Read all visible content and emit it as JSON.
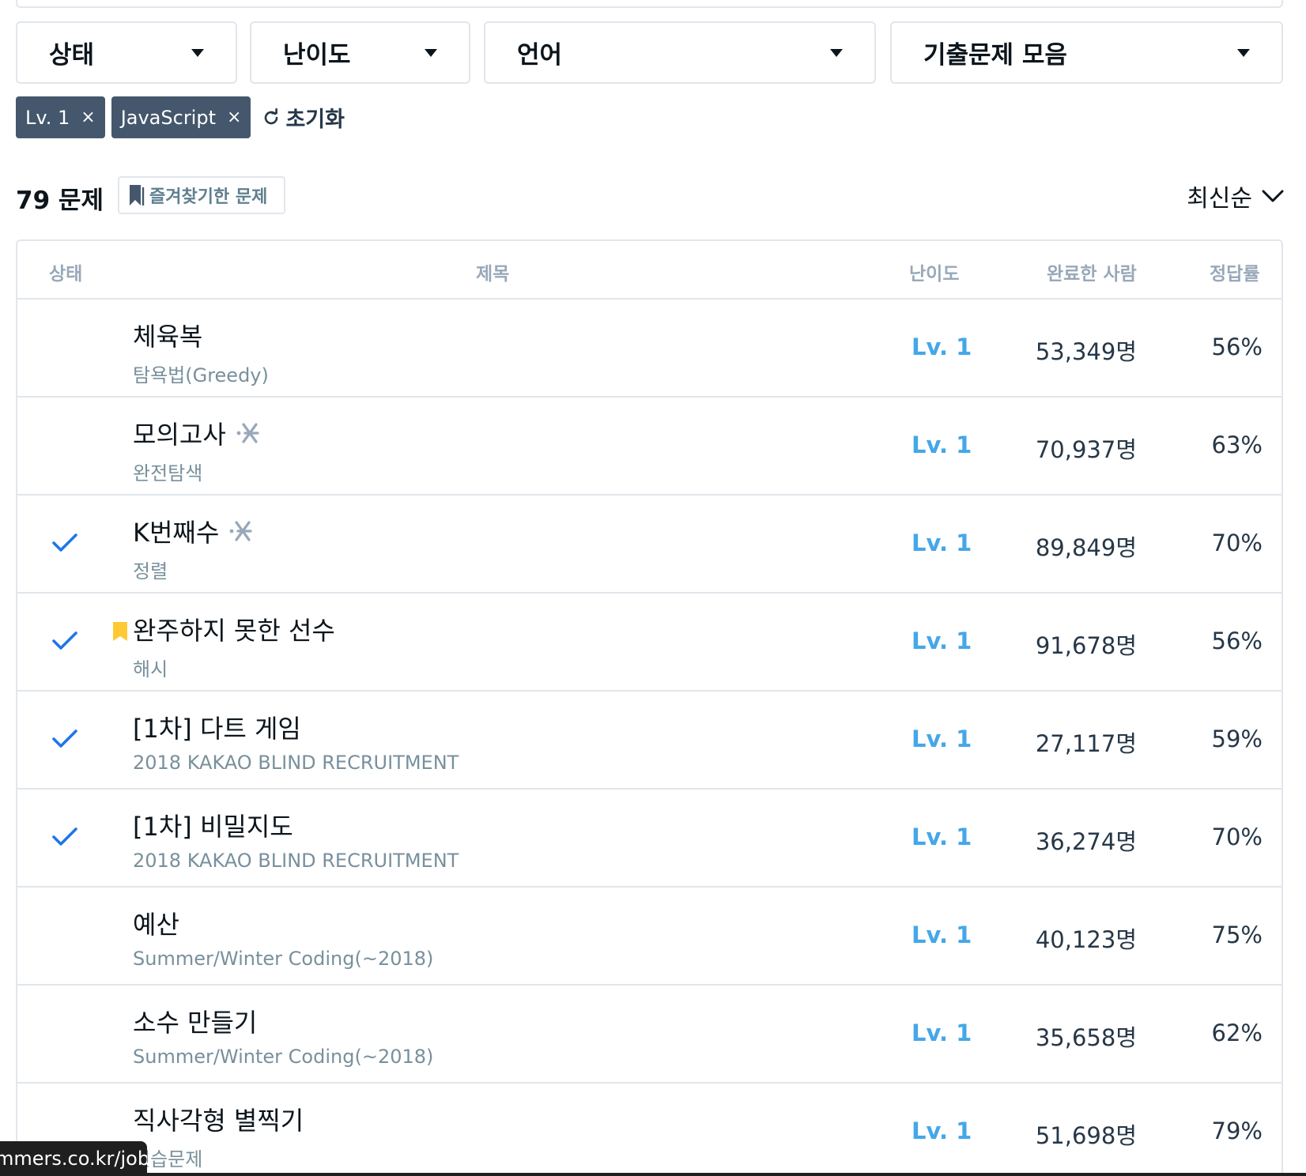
{
  "filters": {
    "status": "상태",
    "difficulty": "난이도",
    "language": "언어",
    "collection": "기출문제 모음"
  },
  "chips": [
    {
      "label": "Lv. 1",
      "remove": "×"
    },
    {
      "label": "JavaScript",
      "remove": "×"
    }
  ],
  "reset_label": "초기화",
  "count_label": "79 문제",
  "bookmark_filter_label": "즐겨찾기한 문제",
  "sort_label": "최신순",
  "table": {
    "headers": {
      "status": "상태",
      "title": "제목",
      "level": "난이도",
      "done": "완료한 사람",
      "rate": "정답률"
    },
    "rows": [
      {
        "title": "체육복",
        "category": "탐욕법(Greedy)",
        "level": "Lv. 1",
        "done": "53,349명",
        "rate": "56%",
        "solved": false,
        "bookmarked": false,
        "sparkle": false
      },
      {
        "title": "모의고사",
        "category": "완전탐색",
        "level": "Lv. 1",
        "done": "70,937명",
        "rate": "63%",
        "solved": false,
        "bookmarked": false,
        "sparkle": true
      },
      {
        "title": "K번째수",
        "category": "정렬",
        "level": "Lv. 1",
        "done": "89,849명",
        "rate": "70%",
        "solved": true,
        "bookmarked": false,
        "sparkle": true
      },
      {
        "title": "완주하지 못한 선수",
        "category": "해시",
        "level": "Lv. 1",
        "done": "91,678명",
        "rate": "56%",
        "solved": true,
        "bookmarked": true,
        "sparkle": false
      },
      {
        "title": "[1차] 다트 게임",
        "category": "2018 KAKAO BLIND RECRUITMENT",
        "level": "Lv. 1",
        "done": "27,117명",
        "rate": "59%",
        "solved": true,
        "bookmarked": false,
        "sparkle": false
      },
      {
        "title": "[1차] 비밀지도",
        "category": "2018 KAKAO BLIND RECRUITMENT",
        "level": "Lv. 1",
        "done": "36,274명",
        "rate": "70%",
        "solved": true,
        "bookmarked": false,
        "sparkle": false
      },
      {
        "title": "예산",
        "category": "Summer/Winter Coding(~2018)",
        "level": "Lv. 1",
        "done": "40,123명",
        "rate": "75%",
        "solved": false,
        "bookmarked": false,
        "sparkle": false
      },
      {
        "title": "소수 만들기",
        "category": "Summer/Winter Coding(~2018)",
        "level": "Lv. 1",
        "done": "35,658명",
        "rate": "62%",
        "solved": false,
        "bookmarked": false,
        "sparkle": false
      },
      {
        "title": "직사각형 별찍기",
        "category": "연습문제",
        "level": "Lv. 1",
        "done": "51,698명",
        "rate": "79%",
        "solved": false,
        "bookmarked": false,
        "sparkle": false
      }
    ]
  },
  "status_url": "mmers.co.kr/job",
  "colors": {
    "level": "#44a7e8",
    "check": "#1f76e8",
    "chip": "#44576c",
    "bookmark": "#ffc835",
    "border": "#e1e6ec"
  },
  "icons": {
    "caret": "caret-down-icon",
    "remove": "close-icon",
    "reset": "refresh-icon",
    "bookmark": "bookmark-icon",
    "sort": "chevron-down-icon",
    "solved": "check-icon",
    "new": "sparkle-icon"
  }
}
